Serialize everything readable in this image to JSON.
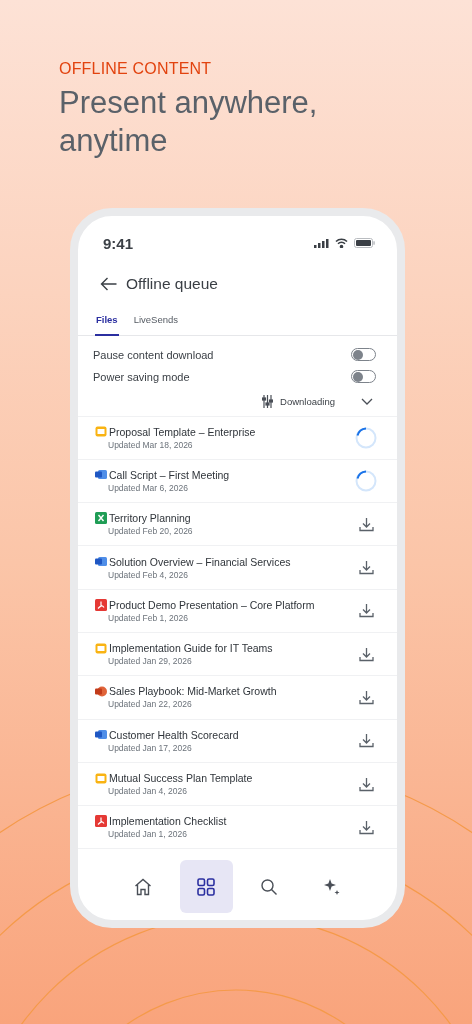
{
  "promo": {
    "eyebrow": "OFFLINE CONTENT",
    "headline": "Present anywhere, anytime"
  },
  "status_bar": {
    "time": "9:41"
  },
  "header": {
    "title": "Offline queue"
  },
  "tabs": [
    {
      "label": "Files",
      "selected": true
    },
    {
      "label": "LiveSends",
      "selected": false
    }
  ],
  "settings": [
    {
      "label": "Pause content download",
      "on": false
    },
    {
      "label": "Power saving mode",
      "on": false
    }
  ],
  "filter": {
    "label": "Downloading"
  },
  "files": [
    {
      "kind": "slides",
      "name": "Proposal Template – Enterprise",
      "updated": "Updated Mar 18, 2026",
      "downloading": true
    },
    {
      "kind": "word",
      "name": "Call Script – First Meeting",
      "updated": "Updated Mar 6, 2026",
      "downloading": true
    },
    {
      "kind": "excel",
      "name": "Territory Planning",
      "updated": "Updated Feb 20, 2026",
      "downloading": false
    },
    {
      "kind": "word",
      "name": "Solution Overview – Financial Services",
      "updated": "Updated Feb 4, 2026",
      "downloading": false
    },
    {
      "kind": "pdf",
      "name": "Product Demo Presentation – Core Platform",
      "updated": "Updated Feb 1, 2026",
      "downloading": false
    },
    {
      "kind": "slides",
      "name": "Implementation Guide for IT Teams",
      "updated": "Updated Jan 29, 2026",
      "downloading": false
    },
    {
      "kind": "powerpoint",
      "name": "Sales Playbook: Mid-Market Growth",
      "updated": "Updated Jan 22, 2026",
      "downloading": false
    },
    {
      "kind": "word",
      "name": "Customer Health Scorecard",
      "updated": "Updated Jan 17, 2026",
      "downloading": false
    },
    {
      "kind": "slides",
      "name": "Mutual Success Plan Template",
      "updated": "Updated Jan 4, 2026",
      "downloading": false
    },
    {
      "kind": "pdf",
      "name": "Implementation Checklist",
      "updated": "Updated Jan 1, 2026",
      "downloading": false
    }
  ],
  "nav": [
    {
      "kind": "home",
      "selected": false
    },
    {
      "kind": "grid",
      "selected": true
    },
    {
      "kind": "search",
      "selected": false
    },
    {
      "kind": "sparkle",
      "selected": false
    }
  ]
}
